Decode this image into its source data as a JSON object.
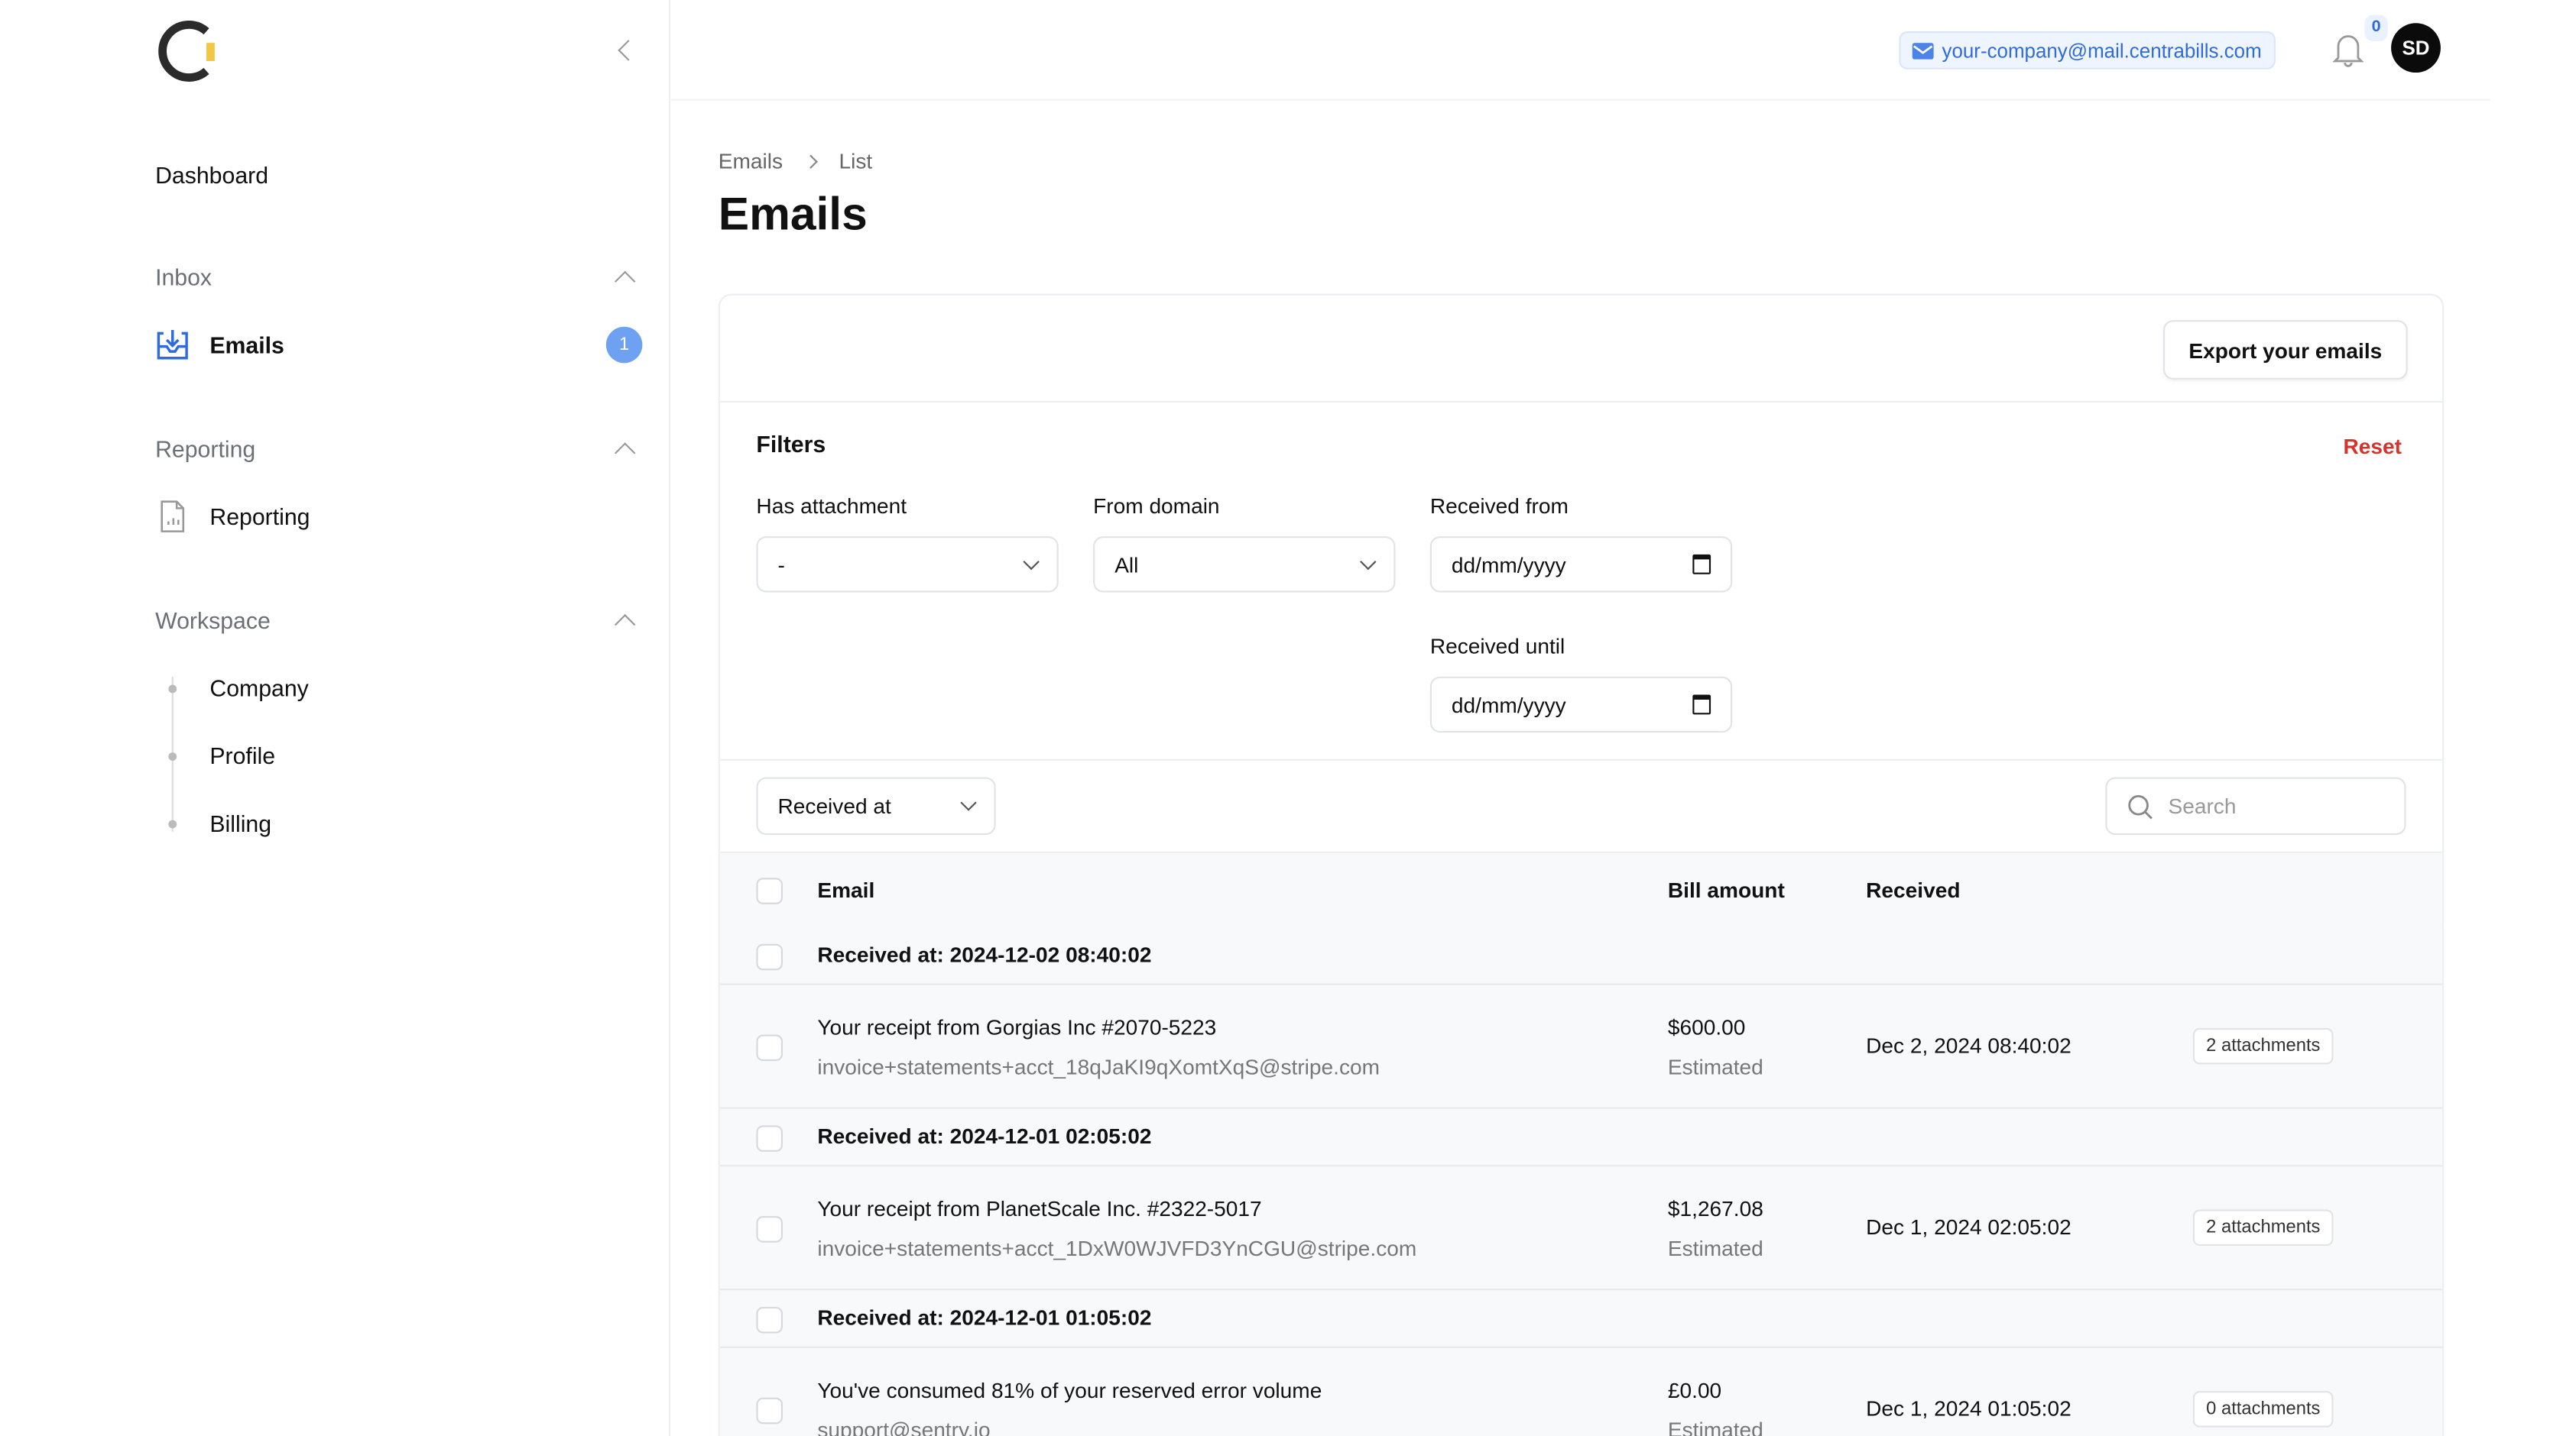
{
  "sidebar": {
    "dashboard": "Dashboard",
    "sections": [
      {
        "label": "Inbox",
        "items": [
          {
            "label": "Emails",
            "badge": "1",
            "icon": "inbox-download-icon"
          }
        ]
      },
      {
        "label": "Reporting",
        "items": [
          {
            "label": "Reporting",
            "icon": "report-file-icon"
          }
        ]
      },
      {
        "label": "Workspace",
        "items": [
          {
            "label": "Company"
          },
          {
            "label": "Profile"
          },
          {
            "label": "Billing"
          }
        ]
      }
    ]
  },
  "header": {
    "inbox_address": "your-company@mail.centrabills.com",
    "notifications_count": "0",
    "avatar_initials": "SD"
  },
  "breadcrumb": [
    "Emails",
    "List"
  ],
  "page_title": "Emails",
  "export_label": "Export your emails",
  "filters": {
    "title": "Filters",
    "reset": "Reset",
    "has_attachment": {
      "label": "Has attachment",
      "value": "-"
    },
    "from_domain": {
      "label": "From domain",
      "value": "All"
    },
    "received_from": {
      "label": "Received from",
      "value": "dd/mm/yyyy"
    },
    "received_until": {
      "label": "Received until",
      "value": "dd/mm/yyyy"
    }
  },
  "toolbar": {
    "sort": "Received at",
    "search_placeholder": "Search"
  },
  "table": {
    "columns": [
      "Email",
      "Bill amount",
      "Received"
    ],
    "groups": [
      {
        "label": "Received at: 2024-12-02 08:40:02",
        "subject": "Your receipt from Gorgias Inc #2070-5223",
        "sender": "invoice+statements+acct_18qJaKI9qXomtXqS@stripe.com",
        "amount": "$600.00",
        "amount_note": "Estimated",
        "received": "Dec 2, 2024 08:40:02",
        "attachments": "2 attachments"
      },
      {
        "label": "Received at: 2024-12-01 02:05:02",
        "subject": "Your receipt from PlanetScale Inc. #2322-5017",
        "sender": "invoice+statements+acct_1DxW0WJVFD3YnCGU@stripe.com",
        "amount": "$1,267.08",
        "amount_note": "Estimated",
        "received": "Dec 1, 2024 02:05:02",
        "attachments": "2 attachments"
      },
      {
        "label": "Received at: 2024-12-01 01:05:02",
        "subject": "You've consumed 81% of your reserved error volume",
        "sender": "support@sentry.io",
        "amount": "£0.00",
        "amount_note": "Estimated",
        "received": "Dec 1, 2024 01:05:02",
        "attachments": "0 attachments"
      }
    ]
  },
  "colors": {
    "accent": "#2f6bdc",
    "badge": "#6ea1f2",
    "reset": "#d6332a",
    "logo_yellow": "#f2c744"
  }
}
